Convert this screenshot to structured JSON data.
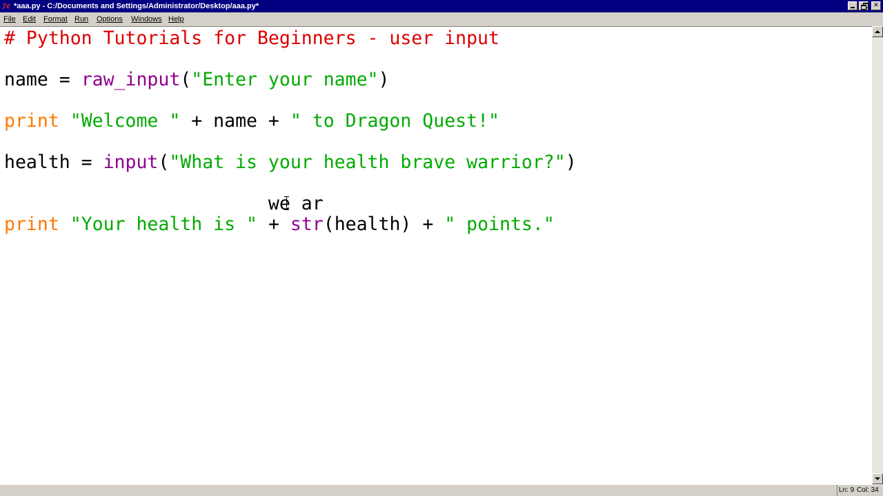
{
  "window": {
    "title": "*aaa.py - C:/Documents and Settings/Administrator/Desktop/aaa.py*",
    "app_icon": "7¢"
  },
  "menubar": {
    "items": [
      {
        "label": "File"
      },
      {
        "label": "Edit"
      },
      {
        "label": "Format"
      },
      {
        "label": "Run"
      },
      {
        "label": "Options"
      },
      {
        "label": "Windows"
      },
      {
        "label": "Help"
      }
    ]
  },
  "editor": {
    "lines": [
      [
        {
          "t": "# Python Tutorials for Beginners - user input",
          "k": "comment"
        }
      ],
      [],
      [
        {
          "t": "name = ",
          "k": "plain"
        },
        {
          "t": "raw_input",
          "k": "builtin"
        },
        {
          "t": "(",
          "k": "plain"
        },
        {
          "t": "\"Enter your name\"",
          "k": "string"
        },
        {
          "t": ")",
          "k": "plain"
        }
      ],
      [],
      [
        {
          "t": "print",
          "k": "keyword"
        },
        {
          "t": " ",
          "k": "plain"
        },
        {
          "t": "\"Welcome \"",
          "k": "string"
        },
        {
          "t": " + name + ",
          "k": "plain"
        },
        {
          "t": "\" to Dragon Quest!\"",
          "k": "string"
        }
      ],
      [],
      [
        {
          "t": "health = ",
          "k": "plain"
        },
        {
          "t": "input",
          "k": "builtin"
        },
        {
          "t": "(",
          "k": "plain"
        },
        {
          "t": "\"What is your health brave warrior?\"",
          "k": "string"
        },
        {
          "t": ")",
          "k": "plain"
        }
      ],
      [],
      [
        {
          "t": "                        we ar",
          "k": "plain"
        }
      ],
      [
        {
          "t": "print",
          "k": "keyword"
        },
        {
          "t": " ",
          "k": "plain"
        },
        {
          "t": "\"Your health is \"",
          "k": "string"
        },
        {
          "t": " + ",
          "k": "plain"
        },
        {
          "t": "str",
          "k": "builtin"
        },
        {
          "t": "(health) + ",
          "k": "plain"
        },
        {
          "t": "\" points.\"",
          "k": "string"
        }
      ]
    ]
  },
  "statusbar": {
    "line": "Ln: 9",
    "column": "Col: 34"
  },
  "colors": {
    "title_bar": "#000080",
    "comment": "#dd0000",
    "keyword": "#ff7700",
    "builtin": "#900090",
    "string": "#00aa00"
  },
  "icons": {
    "app": "idle-python-icon",
    "minimize": "minimize-icon",
    "maximize": "restore-icon",
    "close": "close-icon",
    "scroll_up": "arrow-up-icon",
    "scroll_down": "arrow-down-icon",
    "text_cursor": "i-beam-cursor-icon"
  }
}
